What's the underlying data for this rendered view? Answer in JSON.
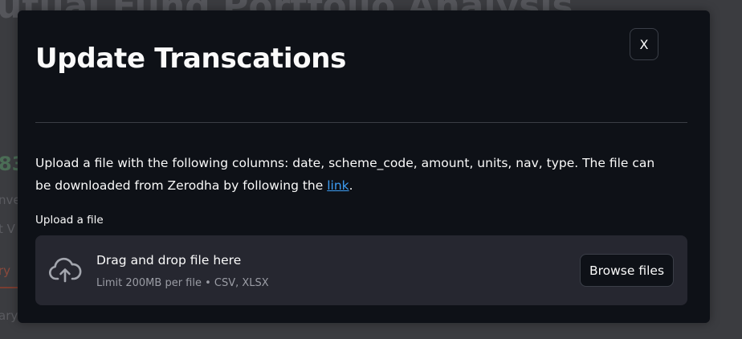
{
  "background": {
    "title_fragment": "utual Fund Portfolio Analysis",
    "fragments": [
      "83",
      "nve",
      "t V",
      "ry",
      "ary"
    ]
  },
  "modal": {
    "title": "Update Transcations",
    "close_label": "X",
    "description_text": "Upload a file with the following columns: date, scheme_code, amount, units, nav, type. The file can be downloaded from Zerodha by following the ",
    "description_link": "link",
    "description_end": ".",
    "upload_label": "Upload a file",
    "dropzone": {
      "title": "Drag and drop file here",
      "limit_text": "Limit 200MB per file • CSV, XLSX",
      "icon": "cloud-upload-icon",
      "browse_label": "Browse files"
    }
  },
  "colors": {
    "modal_bg": "#0e1117",
    "dropzone_bg": "#262730",
    "link": "#3d9df3",
    "text": "#fafafa",
    "muted": "#9a9ca4"
  }
}
